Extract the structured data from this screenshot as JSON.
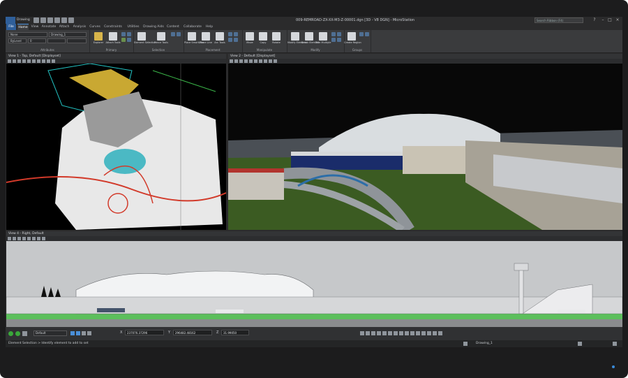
{
  "window": {
    "title": "009-REMROAD-ZX-XX-M3-Z-00001.dgn [3D - V8 DGN] - MicroStation",
    "search_placeholder": "Search Ribbon (F4)",
    "quick_access_workflow": "Drawing"
  },
  "tabs": [
    "File",
    "Home",
    "View",
    "Annotate",
    "Attach",
    "Analysis",
    "Curves",
    "Constraints",
    "Utilities",
    "Drawing Aids",
    "Content",
    "Collaborate",
    "Help"
  ],
  "active_tab": "Home",
  "ribbon": {
    "attributes": {
      "label": "Attributes",
      "level_value": "None",
      "style_value": "Drawing_1",
      "color_value": "ByLevel",
      "weight_value": "0"
    },
    "primary": {
      "label": "Primary",
      "buttons": [
        "Explorer",
        "Attach Tools"
      ]
    },
    "selection": {
      "label": "Selection",
      "buttons": [
        "Element Selection",
        "Fence Tools"
      ]
    },
    "placement": {
      "label": "Placement",
      "buttons": [
        "Place SmartLine",
        "Place Line",
        "Arc Tools"
      ]
    },
    "manipulate": {
      "label": "Manipulate",
      "buttons": [
        "Move",
        "Copy",
        "Rotate"
      ]
    },
    "modify": {
      "label": "Modify",
      "buttons": [
        "Modify Element",
        "Break Element",
        "Trim Multiple"
      ]
    },
    "groups": {
      "label": "Groups",
      "buttons": [
        "Create Region"
      ]
    }
  },
  "views": [
    {
      "title": "View 1 - Top, Default [Displayset]"
    },
    {
      "title": "View 2 - Default [Displayset]"
    },
    {
      "title": "View 4 - Right, Default"
    }
  ],
  "status": {
    "view_group": "Default",
    "x_label": "X",
    "x_value": "237076.37296",
    "y_label": "Y",
    "y_value": "296482.48162",
    "z_label": "Z",
    "z_value": "31.99050",
    "prompt": "Element Selection > Identify element to add to set",
    "model": "Drawing_1"
  },
  "colors": {
    "accent": "#4a8fd8",
    "ribbon_bg": "#3a3b3d",
    "bezel": "#1c1c1d"
  }
}
